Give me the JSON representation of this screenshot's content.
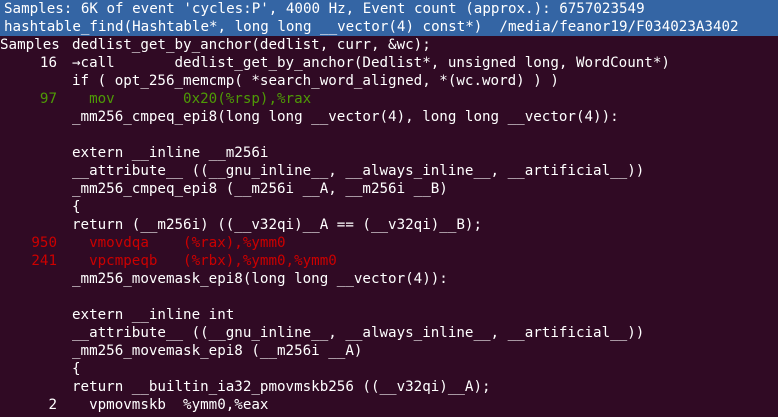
{
  "header": {
    "line1": "Samples: 6K of event 'cycles:P', 4000 Hz, Event count (approx.): 6757023549",
    "line2": "hashtable_find(Hashtable*, long long __vector(4) const*)  /media/feanor19/F034023A3402"
  },
  "gutter_header": "Samples",
  "lines": [
    {
      "count": "",
      "text": "dedlist_get_by_anchor(dedlist, curr, &wc);",
      "kind": "src"
    },
    {
      "count": "16",
      "text": "→call       dedlist_get_by_anchor(Dedlist*, unsigned long, WordCount*)",
      "kind": "src"
    },
    {
      "count": "",
      "text": "if ( opt_256_memcmp( *search_word_aligned, *(wc.word) ) )",
      "kind": "src"
    },
    {
      "count": "97",
      "text": "  mov        0x20(%rsp),%rax",
      "kind": "asm-green"
    },
    {
      "count": "",
      "text": "_mm256_cmpeq_epi8(long long __vector(4), long long __vector(4)):",
      "kind": "src"
    },
    {
      "count": "",
      "text": "",
      "kind": "src"
    },
    {
      "count": "",
      "text": "extern __inline __m256i",
      "kind": "src"
    },
    {
      "count": "",
      "text": "__attribute__ ((__gnu_inline__, __always_inline__, __artificial__))",
      "kind": "src"
    },
    {
      "count": "",
      "text": "_mm256_cmpeq_epi8 (__m256i __A, __m256i __B)",
      "kind": "src"
    },
    {
      "count": "",
      "text": "{",
      "kind": "src"
    },
    {
      "count": "",
      "text": "return (__m256i) ((__v32qi)__A == (__v32qi)__B);",
      "kind": "src"
    },
    {
      "count": "950",
      "text": "  vmovdqa    (%rax),%ymm0",
      "kind": "asm-red"
    },
    {
      "count": "241",
      "text": "  vpcmpeqb   (%rbx),%ymm0,%ymm0",
      "kind": "asm-red"
    },
    {
      "count": "",
      "text": "_mm256_movemask_epi8(long long __vector(4)):",
      "kind": "src"
    },
    {
      "count": "",
      "text": "",
      "kind": "src"
    },
    {
      "count": "",
      "text": "extern __inline int",
      "kind": "src"
    },
    {
      "count": "",
      "text": "__attribute__ ((__gnu_inline__, __always_inline__, __artificial__))",
      "kind": "src"
    },
    {
      "count": "",
      "text": "_mm256_movemask_epi8 (__m256i __A)",
      "kind": "src"
    },
    {
      "count": "",
      "text": "{",
      "kind": "src"
    },
    {
      "count": "",
      "text": "return __builtin_ia32_pmovmskb256 ((__v32qi)__A);",
      "kind": "src"
    },
    {
      "count": "2",
      "text": "  vpmovmskb  %ymm0,%eax",
      "kind": "asm-white"
    }
  ],
  "colors": {
    "background": "#300a24",
    "header_bg": "#3465a4",
    "hot_asm": "#cc0000",
    "warm_asm": "#4e9a06",
    "text": "#ffffff"
  }
}
